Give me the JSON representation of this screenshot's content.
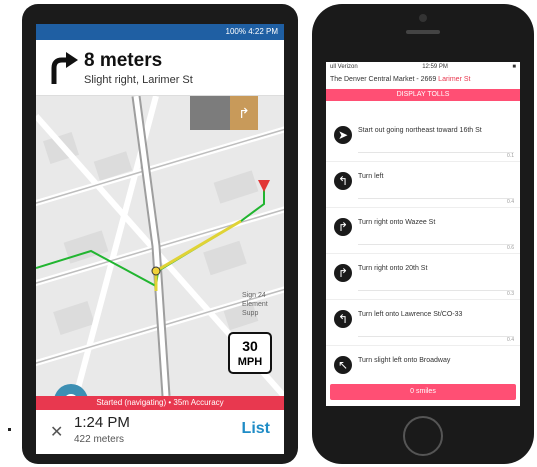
{
  "android": {
    "status_bar": "100% 4:22 PM",
    "instruction": {
      "distance": "8 meters",
      "street": "Slight right, Larimer St"
    },
    "map": {
      "speed_value": "30",
      "speed_unit": "MPH",
      "labels": [
        "Sign 24",
        "Element",
        "Supp"
      ]
    },
    "status_text": "Started (navigating) • 35m Accuracy",
    "bottom": {
      "time": "1:24 PM",
      "meters": "422 meters",
      "list_label": "List"
    }
  },
  "iphone": {
    "status": {
      "carrier": "ull Verizon",
      "time": "12:59 PM",
      "battery": "■"
    },
    "title_prefix": "The Denver Central Market - 2669 ",
    "title_highlight": "Larimer St",
    "display_tolls": "DISPLAY TOLLS",
    "steps": [
      {
        "icon": "start-arrow-icon",
        "glyph": "➤",
        "text": "Start out going northeast toward 16th St",
        "dist": "0.1"
      },
      {
        "icon": "turn-left-icon",
        "glyph": "↰",
        "text": "Turn left",
        "dist": "0.4"
      },
      {
        "icon": "turn-right-icon",
        "glyph": "↱",
        "text": "Turn right onto Wazee St",
        "dist": "0.6"
      },
      {
        "icon": "turn-right-icon",
        "glyph": "↱",
        "text": "Turn right onto 20th St",
        "dist": "0.3"
      },
      {
        "icon": "turn-left-icon",
        "glyph": "↰",
        "text": "Turn left onto Lawrence St/CO-33",
        "dist": "0.4"
      },
      {
        "icon": "slight-left-icon",
        "glyph": "↖",
        "text": "Turn slight left onto Broadway",
        "dist": ""
      }
    ],
    "bottom_button": "0 smiles"
  }
}
